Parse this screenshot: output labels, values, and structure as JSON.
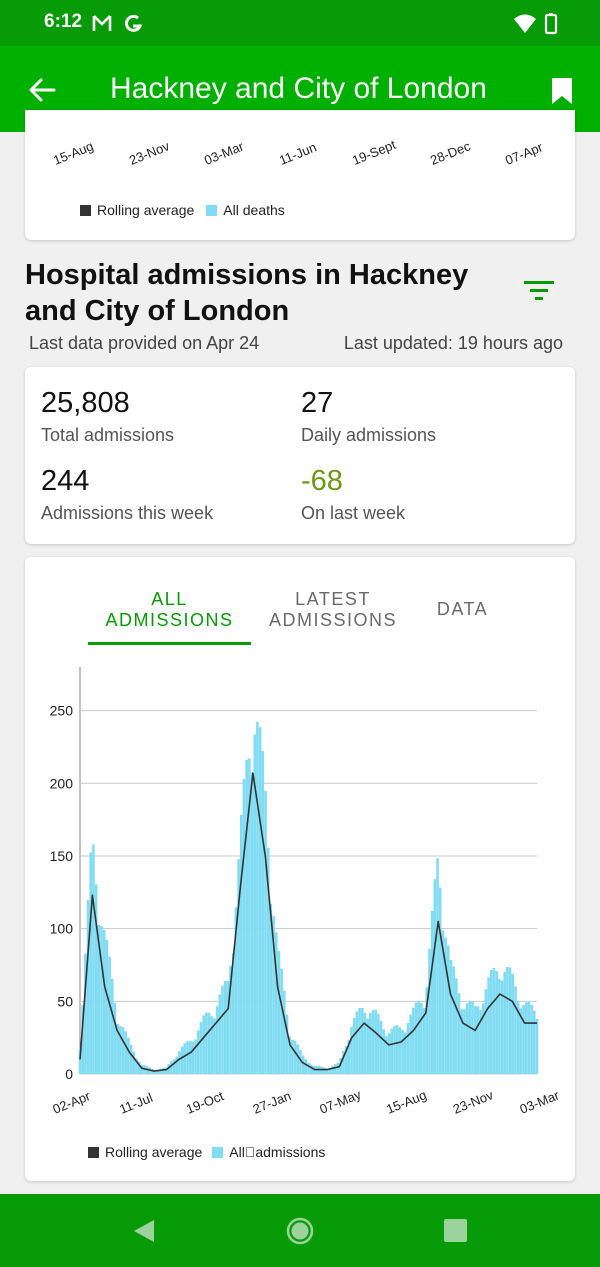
{
  "status_bar": {
    "time": "6:12"
  },
  "app_bar": {
    "title": "Hackney and City of London"
  },
  "deaths_chart": {
    "x_ticks": [
      "15-Aug",
      "23-Nov",
      "03-Mar",
      "11-Jun",
      "19-Sept",
      "28-Dec",
      "07-Apr"
    ],
    "legend": {
      "rolling": "Rolling average",
      "all": "All deaths"
    }
  },
  "section": {
    "title": "Hospital admissions in Hackney and City of London",
    "last_data": "Last data provided on Apr 24",
    "last_updated": "Last updated: 19 hours ago"
  },
  "stats": {
    "total": {
      "value": "25,808",
      "label": "Total admissions"
    },
    "daily": {
      "value": "27",
      "label": "Daily admissions"
    },
    "week": {
      "value": "244",
      "label": "Admissions this week"
    },
    "change": {
      "value": "-68",
      "label": "On last week"
    }
  },
  "tabs": {
    "all": "ALL\nADMISSIONS",
    "latest": "LATEST\nADMISSIONS",
    "data": "DATA"
  },
  "colors": {
    "bar_green": "#00b000",
    "status_green": "#079b07",
    "series_light": "#80dcf2",
    "series_dark": "#333333",
    "change_green": "#6a9a14"
  },
  "chart_data": {
    "type": "area",
    "title": "",
    "xlabel": "",
    "ylabel": "",
    "ylim": [
      0,
      280
    ],
    "y_ticks": [
      0,
      50,
      100,
      150,
      200,
      250
    ],
    "grid": true,
    "legend_placement": "bottom",
    "x_tick_labels": [
      "02-Apr",
      "11-Jul",
      "19-Oct",
      "27-Jan",
      "07-May",
      "15-Aug",
      "23-Nov",
      "03-Mar"
    ],
    "x": [
      "02-Apr",
      "20-Apr",
      "15-May",
      "11-Jun",
      "11-Jul",
      "11-Aug",
      "10-Sep",
      "05-Oct",
      "19-Oct",
      "01-Nov",
      "15-Nov",
      "30-Nov",
      "12-Dec",
      "26-Dec",
      "10-Jan",
      "22-Jan",
      "27-Jan",
      "08-Feb",
      "25-Feb",
      "20-Mar",
      "07-May",
      "20-Jun",
      "01-Aug",
      "15-Aug",
      "01-Sep",
      "01-Oct",
      "29-Oct",
      "15-Nov",
      "23-Nov",
      "30-Nov",
      "14-Dec",
      "04-Jan",
      "20-Jan",
      "10-Feb",
      "26-Feb",
      "03-Mar",
      "15-Mar",
      "25-Mar"
    ],
    "series": [
      {
        "name": "Rolling average",
        "values": [
          10,
          123,
          60,
          30,
          15,
          4,
          2,
          3,
          10,
          15,
          25,
          35,
          45,
          130,
          207,
          150,
          60,
          20,
          8,
          3,
          3,
          5,
          25,
          35,
          28,
          20,
          22,
          30,
          42,
          105,
          55,
          35,
          30,
          45,
          55,
          50,
          35,
          35
        ]
      },
      {
        "name": "All admissions",
        "values": [
          20,
          150,
          90,
          40,
          20,
          6,
          3,
          4,
          15,
          22,
          35,
          45,
          60,
          150,
          250,
          180,
          80,
          28,
          12,
          5,
          4,
          7,
          32,
          45,
          38,
          28,
          30,
          40,
          55,
          140,
          70,
          48,
          42,
          58,
          72,
          62,
          45,
          40
        ]
      }
    ],
    "legend": [
      "Rolling average",
      "All admissions"
    ],
    "legend_display": {
      "rolling": "Rolling average",
      "all": "All\u0000admissions"
    }
  }
}
